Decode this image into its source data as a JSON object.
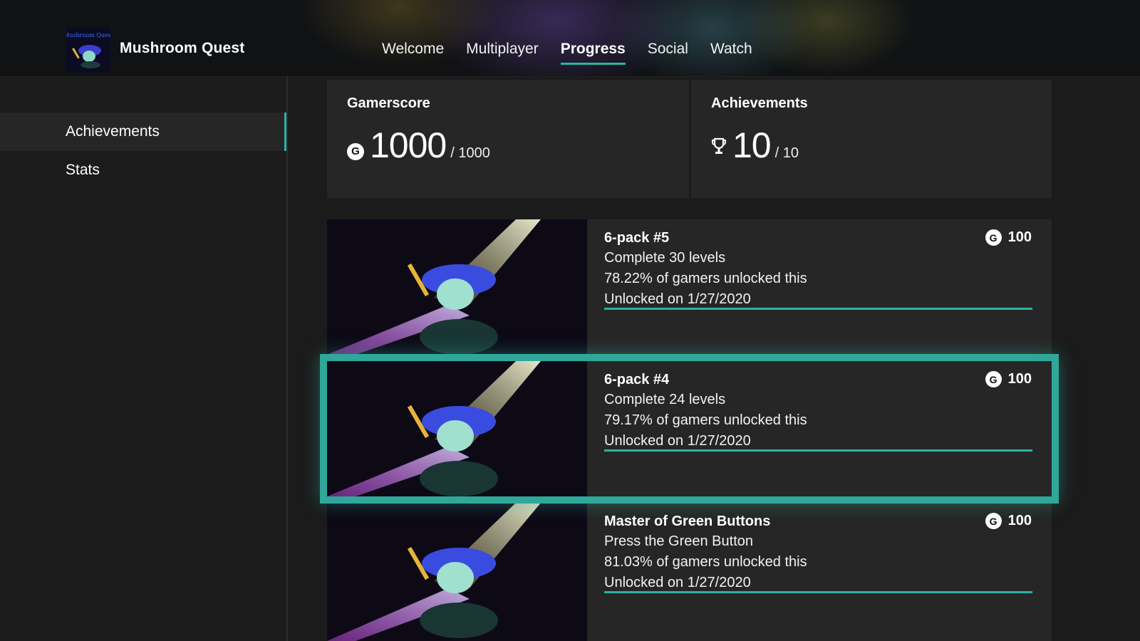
{
  "app": {
    "title": "Mushroom Quest",
    "logo_text": "Mushroom Quest"
  },
  "nav": {
    "tabs": [
      {
        "label": "Welcome",
        "active": false
      },
      {
        "label": "Multiplayer",
        "active": false
      },
      {
        "label": "Progress",
        "active": true
      },
      {
        "label": "Social",
        "active": false
      },
      {
        "label": "Watch",
        "active": false
      }
    ]
  },
  "sidebar": {
    "items": [
      {
        "label": "Achievements",
        "active": true
      },
      {
        "label": "Stats",
        "active": false
      }
    ]
  },
  "summary": {
    "gamerscore": {
      "label": "Gamerscore",
      "badge": "G",
      "value": "1000",
      "total": "/ 1000"
    },
    "achievements": {
      "label": "Achievements",
      "value": "10",
      "total": "/ 10"
    }
  },
  "achievements": [
    {
      "name": "6-pack #5",
      "description": "Complete 30 levels",
      "rarity": "78.22% of gamers unlocked this",
      "unlocked": "Unlocked on 1/27/2020",
      "score": "100",
      "badge": "G",
      "progress": 1.0
    },
    {
      "name": "6-pack #4",
      "description": "Complete 24 levels",
      "rarity": "79.17% of gamers unlocked this",
      "unlocked": "Unlocked on 1/27/2020",
      "score": "100",
      "badge": "G",
      "progress": 1.0,
      "focused": true
    },
    {
      "name": "Master of Green Buttons",
      "description": "Press the Green Button",
      "rarity": "81.03% of gamers unlocked this",
      "unlocked": "Unlocked on 1/27/2020",
      "score": "100",
      "badge": "G",
      "progress": 1.0
    }
  ],
  "colors": {
    "accent": "#2bb3a3",
    "background": "#1b1b1b",
    "card": "#262626"
  }
}
